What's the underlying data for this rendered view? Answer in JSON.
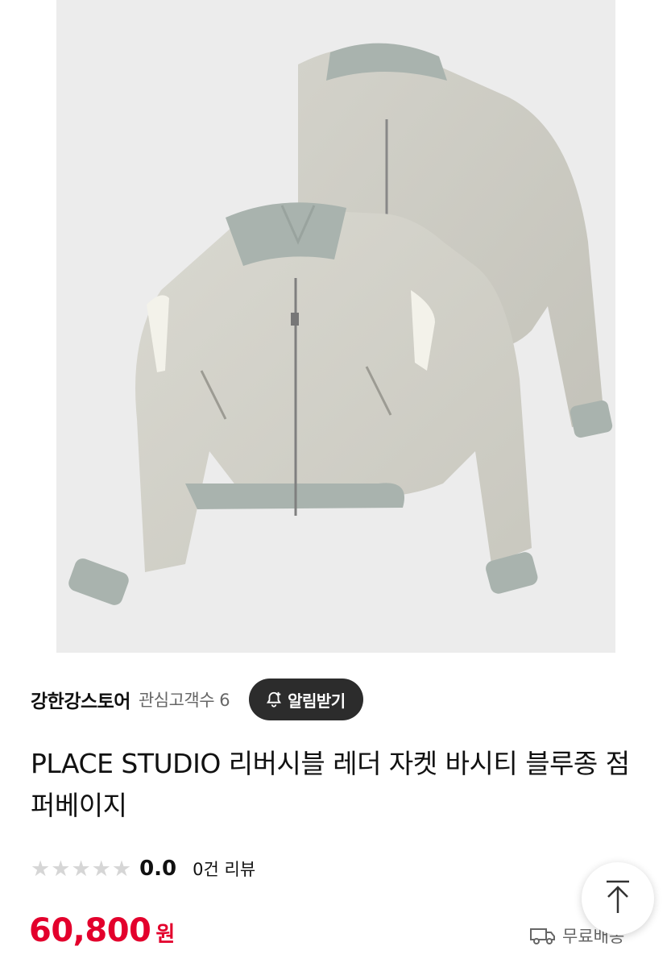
{
  "product": {
    "image_alt": "product-image",
    "title": "PLACE STUDIO 리버시블 레더 자켓 바시티 블루종 점퍼베이지"
  },
  "store": {
    "name": "강한강스토어",
    "followers_label": "관심고객수 6",
    "follow_button_label": "알림받기"
  },
  "rating": {
    "score": "0.0",
    "review_count_label": "0건 리뷰",
    "stars_filled": 0,
    "stars_total": 5
  },
  "price": {
    "amount": "60,800",
    "currency": "원"
  },
  "shipping": {
    "label": "무료배송"
  },
  "colors": {
    "price": "#e3002c",
    "button_bg": "#2c2c2c",
    "star_empty": "#d6d6d6"
  }
}
